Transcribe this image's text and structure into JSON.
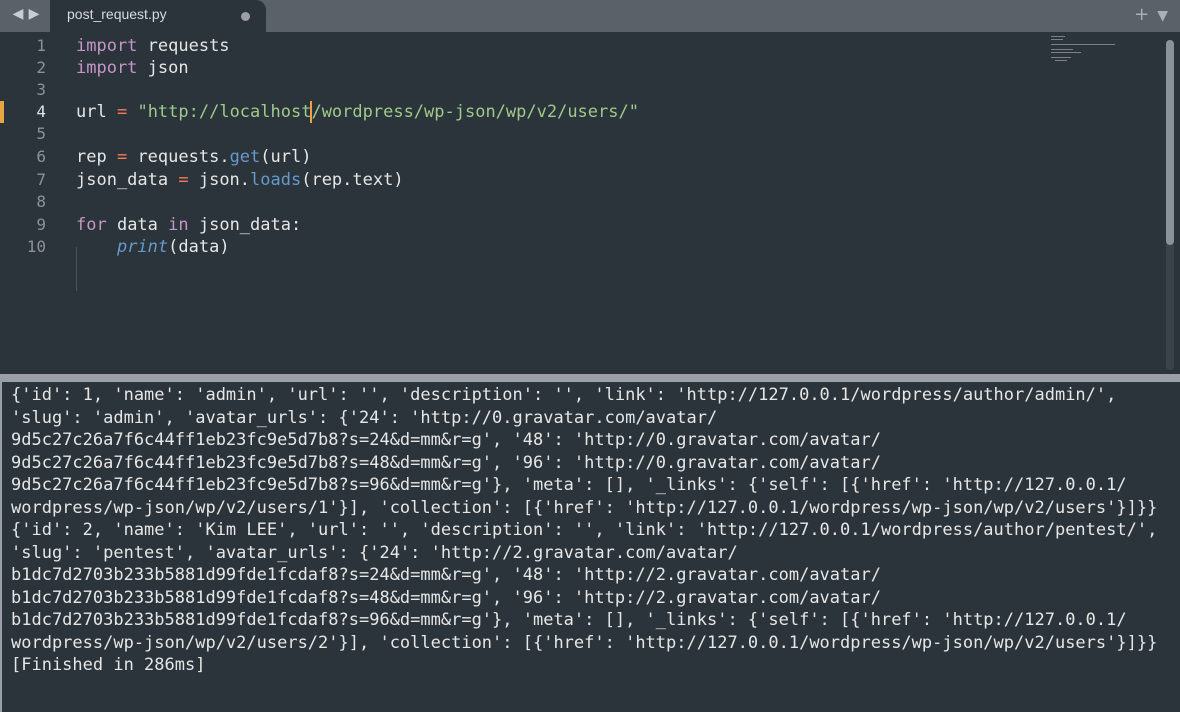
{
  "tabbar": {
    "back_icon": "◀",
    "forward_icon": "▶",
    "tab_label": "post_request.py",
    "add_icon": "+",
    "menu_icon": "▼"
  },
  "editor": {
    "line_numbers": [
      "1",
      "2",
      "3",
      "4",
      "5",
      "6",
      "7",
      "8",
      "9",
      "10"
    ],
    "active_line": "4",
    "code": {
      "l1_kw": "import",
      "l1_rest": " requests",
      "l2_kw": "import",
      "l2_rest": " json",
      "l4_a": "url ",
      "l4_op": "=",
      "l4_b": " ",
      "l4_str1": "\"http://localhost",
      "l4_str2": "/wordpress/wp-json/wp/v2/users/\"",
      "l6_a": "rep ",
      "l6_op": "=",
      "l6_b": " requests.",
      "l6_fn": "get",
      "l6_c": "(url)",
      "l7_a": "json_data ",
      "l7_op": "=",
      "l7_b": " json.",
      "l7_fn": "loads",
      "l7_c": "(rep.text)",
      "l9_kw1": "for",
      "l9_a": " data ",
      "l9_kw2": "in",
      "l9_b": " json_data:",
      "l10_indent": "    ",
      "l10_fn": "print",
      "l10_b": "(data)"
    }
  },
  "output": {
    "lines": [
      "{'id': 1, 'name': 'admin', 'url': '', 'description': '', 'link': 'http://127.0.0.1/wordpress/author/admin/',",
      "'slug': 'admin', 'avatar_urls': {'24': 'http://0.gravatar.com/avatar/",
      "9d5c27c26a7f6c44ff1eb23fc9e5d7b8?s=24&d=mm&r=g', '48': 'http://0.gravatar.com/avatar/",
      "9d5c27c26a7f6c44ff1eb23fc9e5d7b8?s=48&d=mm&r=g', '96': 'http://0.gravatar.com/avatar/",
      "9d5c27c26a7f6c44ff1eb23fc9e5d7b8?s=96&d=mm&r=g'}, 'meta': [], '_links': {'self': [{'href': 'http://127.0.0.1/",
      "wordpress/wp-json/wp/v2/users/1'}], 'collection': [{'href': 'http://127.0.0.1/wordpress/wp-json/wp/v2/users'}]}}",
      "{'id': 2, 'name': 'Kim LEE', 'url': '', 'description': '', 'link': 'http://127.0.0.1/wordpress/author/pentest/',",
      "'slug': 'pentest', 'avatar_urls': {'24': 'http://2.gravatar.com/avatar/",
      "b1dc7d2703b233b5881d99fde1fcdaf8?s=24&d=mm&r=g', '48': 'http://2.gravatar.com/avatar/",
      "b1dc7d2703b233b5881d99fde1fcdaf8?s=48&d=mm&r=g', '96': 'http://2.gravatar.com/avatar/",
      "b1dc7d2703b233b5881d99fde1fcdaf8?s=96&d=mm&r=g'}, 'meta': [], '_links': {'self': [{'href': 'http://127.0.0.1/",
      "wordpress/wp-json/wp/v2/users/2'}], 'collection': [{'href': 'http://127.0.0.1/wordpress/wp-json/wp/v2/users'}]}}",
      "[Finished in 286ms]"
    ]
  },
  "colors": {
    "background": "#2b343b",
    "keyword": "#c695c6",
    "operator": "#f97b58",
    "string": "#9fca8a",
    "function": "#6699cc",
    "cursor": "#f0a040"
  }
}
